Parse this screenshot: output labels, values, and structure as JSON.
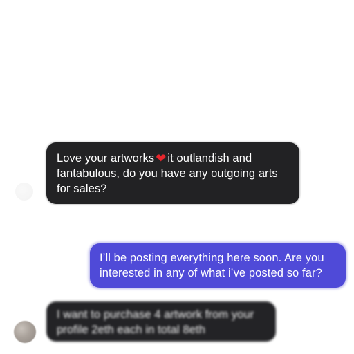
{
  "conversation": {
    "messages": [
      {
        "direction": "received",
        "lines": [
          "Love your artworks",
          "it outlandish and",
          "fantabulous, do you have any outgoing arts",
          "for sales?"
        ],
        "emoji": "heart-emoji"
      },
      {
        "direction": "sent",
        "lines": [
          "I’ll be posting everything here soon. Are you",
          "interested in any of what i’ve posted so far?"
        ]
      },
      {
        "direction": "received",
        "blurred": true,
        "lines": [
          "I want to purchase 4 artwork from your",
          "profile 2eth each in total 8eth"
        ]
      }
    ]
  },
  "colors": {
    "received_bubble": "#222224",
    "sent_bubble": "#4f4ad8",
    "heart": "#e8262c",
    "background": "#ffffff"
  }
}
